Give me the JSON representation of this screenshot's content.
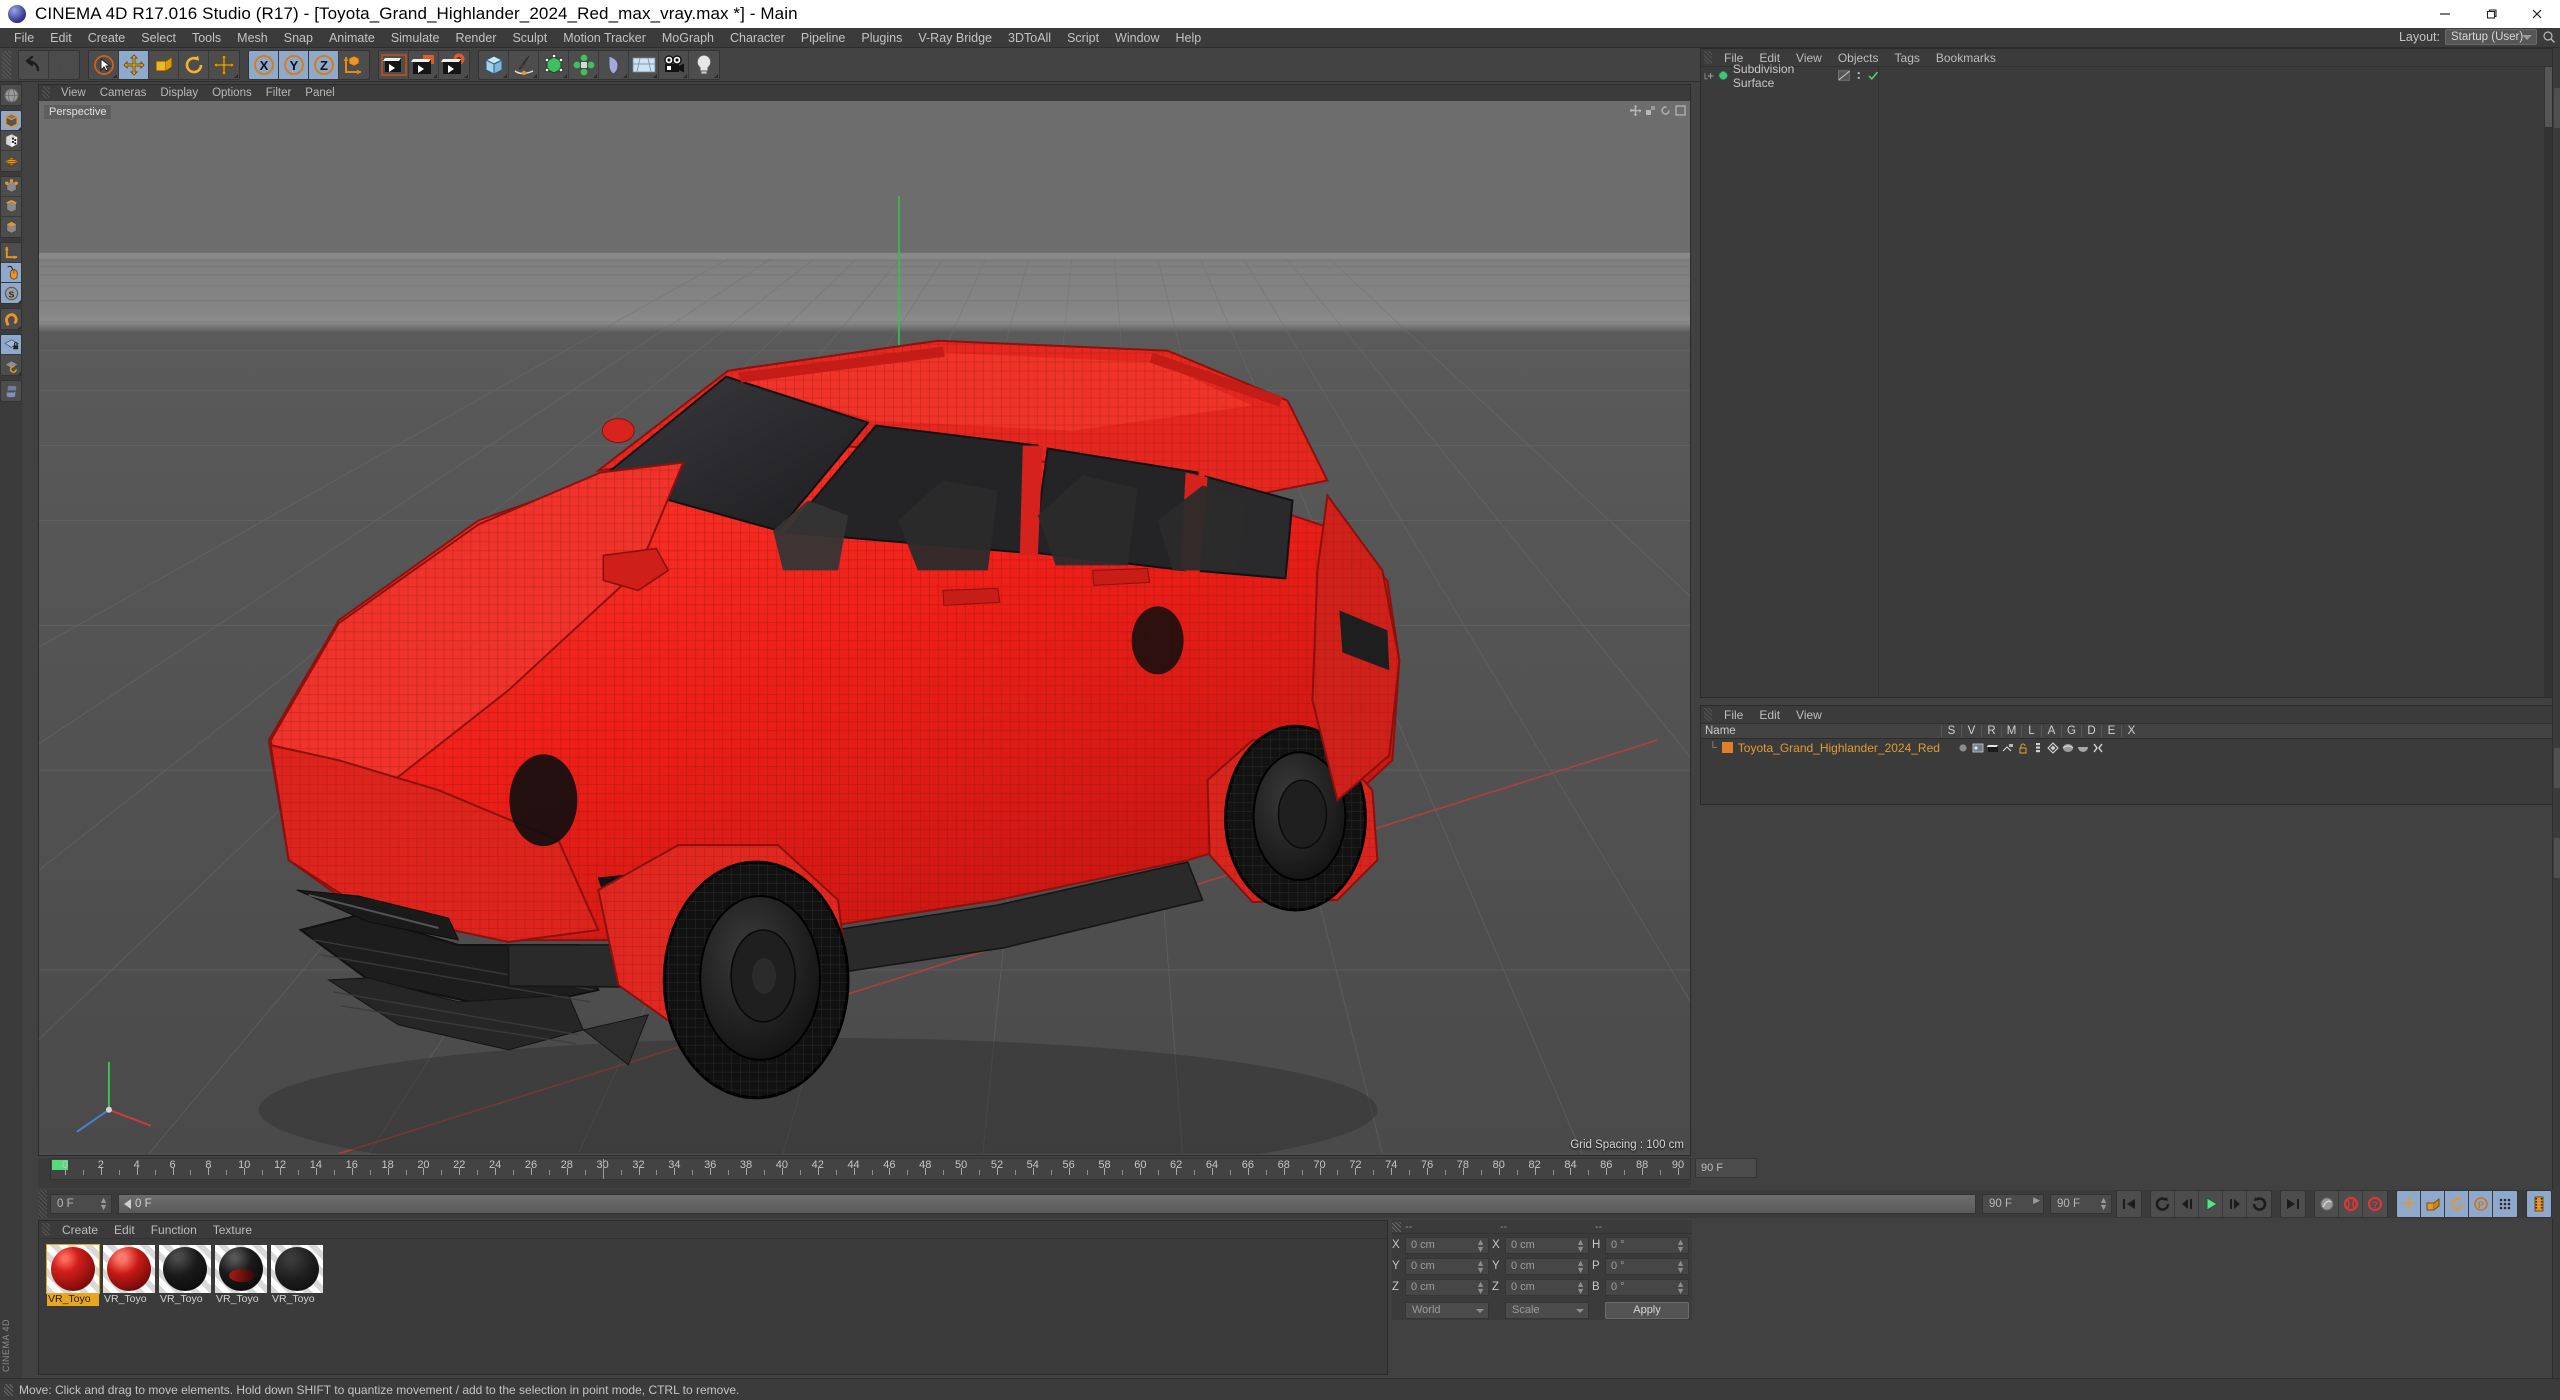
{
  "window": {
    "title": "CINEMA 4D R17.016 Studio (R17) - [Toyota_Grand_Highlander_2024_Red_max_vray.max *] - Main",
    "minimize_label": "—",
    "maximize_label": "❐",
    "close_label": "✕",
    "logo_name": "cinema4d-logo"
  },
  "menubar": {
    "items": [
      "File",
      "Edit",
      "Create",
      "Select",
      "Tools",
      "Mesh",
      "Snap",
      "Animate",
      "Simulate",
      "Render",
      "Sculpt",
      "Motion Tracker",
      "MoGraph",
      "Character",
      "Pipeline",
      "Plugins",
      "V-Ray Bridge",
      "3DToAll",
      "Script",
      "Window",
      "Help"
    ],
    "layout_label": "Layout:",
    "layout_value": "Startup (User)"
  },
  "toolbar": {
    "groups": [
      {
        "name": "history",
        "buttons": [
          {
            "name": "undo-button",
            "icon": "undo",
            "state": "normal"
          },
          {
            "name": "redo-button",
            "icon": "redo",
            "state": "disabled"
          }
        ]
      },
      {
        "name": "tools",
        "buttons": [
          {
            "name": "live-selection-tool",
            "icon": "select",
            "state": "normal"
          },
          {
            "name": "move-tool",
            "icon": "move",
            "state": "selected"
          },
          {
            "name": "scale-tool",
            "icon": "scale",
            "state": "normal"
          },
          {
            "name": "rotate-tool",
            "icon": "rotate",
            "state": "normal"
          },
          {
            "name": "move-alt-tool",
            "icon": "move2",
            "state": "normal"
          }
        ]
      },
      {
        "name": "axis-locks",
        "buttons": [
          {
            "name": "lock-x-axis",
            "icon": "X",
            "state": "selected"
          },
          {
            "name": "lock-y-axis",
            "icon": "Y",
            "state": "selected"
          },
          {
            "name": "lock-z-axis",
            "icon": "Z",
            "state": "selected"
          },
          {
            "name": "world-object-coordinates",
            "icon": "axis",
            "state": "normal"
          }
        ]
      },
      {
        "name": "render",
        "buttons": [
          {
            "name": "render-view-button",
            "icon": "render-view",
            "state": "normal"
          },
          {
            "name": "render-to-picture-viewer-button",
            "icon": "render-pv",
            "state": "normal"
          },
          {
            "name": "render-settings-button",
            "icon": "render-settings",
            "state": "normal"
          }
        ]
      },
      {
        "name": "objects",
        "buttons": [
          {
            "name": "add-cube-button",
            "icon": "cube",
            "state": "normal"
          },
          {
            "name": "add-spline-button",
            "icon": "spline",
            "state": "normal"
          },
          {
            "name": "add-generator-button",
            "icon": "generator",
            "state": "normal"
          },
          {
            "name": "add-array-button",
            "icon": "array",
            "state": "normal"
          },
          {
            "name": "add-deformer-button",
            "icon": "deformer",
            "state": "normal"
          },
          {
            "name": "add-scene-object-button",
            "icon": "environment",
            "state": "normal"
          },
          {
            "name": "add-camera-button",
            "icon": "camera",
            "state": "normal"
          },
          {
            "name": "add-light-button",
            "icon": "light",
            "state": "normal"
          }
        ]
      }
    ]
  },
  "left_toolbar": {
    "groups": [
      {
        "buttons": [
          {
            "name": "undo-view-tool",
            "icon": "globe",
            "state": "normal"
          }
        ]
      },
      {
        "buttons": [
          {
            "name": "model-mode-tool",
            "icon": "model",
            "state": "selected"
          },
          {
            "name": "texture-mode-tool",
            "icon": "texture",
            "state": "normal"
          },
          {
            "name": "workplane-mode-tool",
            "icon": "workplane",
            "state": "normal"
          }
        ]
      },
      {
        "buttons": [
          {
            "name": "points-mode-tool",
            "icon": "points",
            "state": "normal"
          },
          {
            "name": "edges-mode-tool",
            "icon": "edges",
            "state": "normal"
          },
          {
            "name": "polygons-mode-tool",
            "icon": "polygons",
            "state": "normal"
          }
        ]
      },
      {
        "buttons": [
          {
            "name": "object-axis-tool",
            "icon": "axis",
            "state": "normal"
          },
          {
            "name": "viewport-solo-tool",
            "icon": "mouse",
            "state": "selected"
          },
          {
            "name": "scale-lock-tool",
            "icon": "s-disc",
            "state": "selected"
          }
        ]
      },
      {
        "buttons": [
          {
            "name": "enable-snapping-tool",
            "icon": "magnet",
            "state": "normal"
          }
        ]
      },
      {
        "buttons": [
          {
            "name": "workplane-lock-tool",
            "icon": "plane-lock",
            "state": "selected"
          },
          {
            "name": "workplane-rotate-tool",
            "icon": "plane-rotate",
            "state": "normal"
          }
        ]
      },
      {
        "buttons": [
          {
            "name": "python-console-tool",
            "icon": "python",
            "state": "normal"
          }
        ]
      }
    ],
    "brand": "CINEMA 4D"
  },
  "viewport": {
    "menu": [
      "View",
      "Cameras",
      "Display",
      "Options",
      "Filter",
      "Panel"
    ],
    "label": "Perspective",
    "grid_spacing": "Grid Spacing : 100 cm",
    "car_color": "#ee2020",
    "car_color_dark": "#b81313",
    "wire_color": "#8f0f0f",
    "glass_color": "#2a2a2c",
    "tire_color": "#1b1b1b"
  },
  "object_manager": {
    "menu": [
      "File",
      "Edit",
      "View",
      "Objects",
      "Tags",
      "Bookmarks"
    ],
    "items": [
      {
        "name": "Subdivision Surface",
        "icon": "subdivision-surface-icon",
        "checked": true
      }
    ]
  },
  "scene_manager": {
    "menu": [
      "File",
      "Edit",
      "View"
    ],
    "columns": [
      "Name",
      "S",
      "V",
      "R",
      "M",
      "L",
      "A",
      "G",
      "D",
      "E",
      "X"
    ],
    "rows": [
      {
        "name": "Toyota_Grand_Highlander_2024_Red",
        "color": "#e09b36",
        "swatch": "#e07f28"
      }
    ]
  },
  "timeline": {
    "frame_start": 0,
    "frame_end": 90,
    "tick_labels": [
      0,
      2,
      4,
      6,
      8,
      10,
      12,
      14,
      16,
      18,
      20,
      22,
      24,
      26,
      28,
      30,
      32,
      34,
      36,
      38,
      40,
      42,
      44,
      46,
      48,
      50,
      52,
      54,
      56,
      58,
      60,
      62,
      64,
      66,
      68,
      70,
      72,
      74,
      76,
      78,
      80,
      82,
      84,
      86,
      88,
      90
    ],
    "current_frame_field": "0 F",
    "end_frame_field": "90 F",
    "playhead_frame": 30
  },
  "animbar": {
    "current_frame": "0 F",
    "scrub_value": "0 F",
    "preview_end": "90 F",
    "end_frame": "90 F",
    "buttons": [
      {
        "name": "go-to-start-button",
        "icon": "start"
      },
      {
        "name": "go-to-previous-key-button",
        "icon": "prev-key"
      },
      {
        "name": "go-to-previous-frame-button",
        "icon": "prev-frame"
      },
      {
        "name": "play-button",
        "icon": "play"
      },
      {
        "name": "go-to-next-frame-button",
        "icon": "next-frame"
      },
      {
        "name": "go-to-next-key-button",
        "icon": "next-key"
      },
      {
        "name": "go-to-end-button",
        "icon": "end"
      },
      {
        "name": "record-active-objects-button",
        "icon": "record-tools"
      },
      {
        "name": "autokeying-button",
        "icon": "autokey"
      },
      {
        "name": "keyframe-selection-button",
        "icon": "key-select"
      },
      {
        "name": "position-key-button",
        "icon": "position"
      },
      {
        "name": "scale-key-button",
        "icon": "scale"
      },
      {
        "name": "rotation-key-button",
        "icon": "rotation"
      },
      {
        "name": "parameter-key-button",
        "icon": "param"
      },
      {
        "name": "point-level-animation-button",
        "icon": "pla"
      },
      {
        "name": "timeline-view-button",
        "icon": "filmstrip"
      }
    ]
  },
  "material_manager": {
    "menu": [
      "Create",
      "Edit",
      "Function",
      "Texture"
    ],
    "materials": [
      {
        "name": "VR_Toyo",
        "label": "VR_Toyo",
        "selected": true,
        "color": "#cc1d1d",
        "type": "red-flake"
      },
      {
        "name": "VR_Toyo",
        "label": "VR_Toyo",
        "selected": false,
        "color": "#b51818",
        "type": "red-gloss"
      },
      {
        "name": "VR_Toyo",
        "label": "VR_Toyo",
        "selected": false,
        "color": "#171717",
        "type": "black-gloss"
      },
      {
        "name": "VR_Toyo",
        "label": "VR_Toyo",
        "selected": false,
        "color": "#1c1c1c",
        "type": "black-red"
      },
      {
        "name": "VR_Toyo",
        "label": "VR_Toyo",
        "selected": false,
        "color": "#202020",
        "type": "black-matte"
      }
    ]
  },
  "coordinates": {
    "header": [
      "--",
      "--",
      "--"
    ],
    "rows": [
      {
        "label1": "X",
        "value1": "0 cm",
        "label2": "X",
        "value2": "0 cm",
        "label3": "H",
        "value3": "0 °"
      },
      {
        "label1": "Y",
        "value1": "0 cm",
        "label2": "Y",
        "value2": "0 cm",
        "label3": "P",
        "value3": "0 °"
      },
      {
        "label1": "Z",
        "value1": "0 cm",
        "label2": "Z",
        "value2": "0 cm",
        "label3": "B",
        "value3": "0 °"
      }
    ],
    "system_value": "World",
    "mode_value": "Scale",
    "apply_label": "Apply"
  },
  "statusbar": {
    "message": "Move: Click and drag to move elements. Hold down SHIFT to quantize movement / add to the selection in point mode, CTRL to remove."
  }
}
